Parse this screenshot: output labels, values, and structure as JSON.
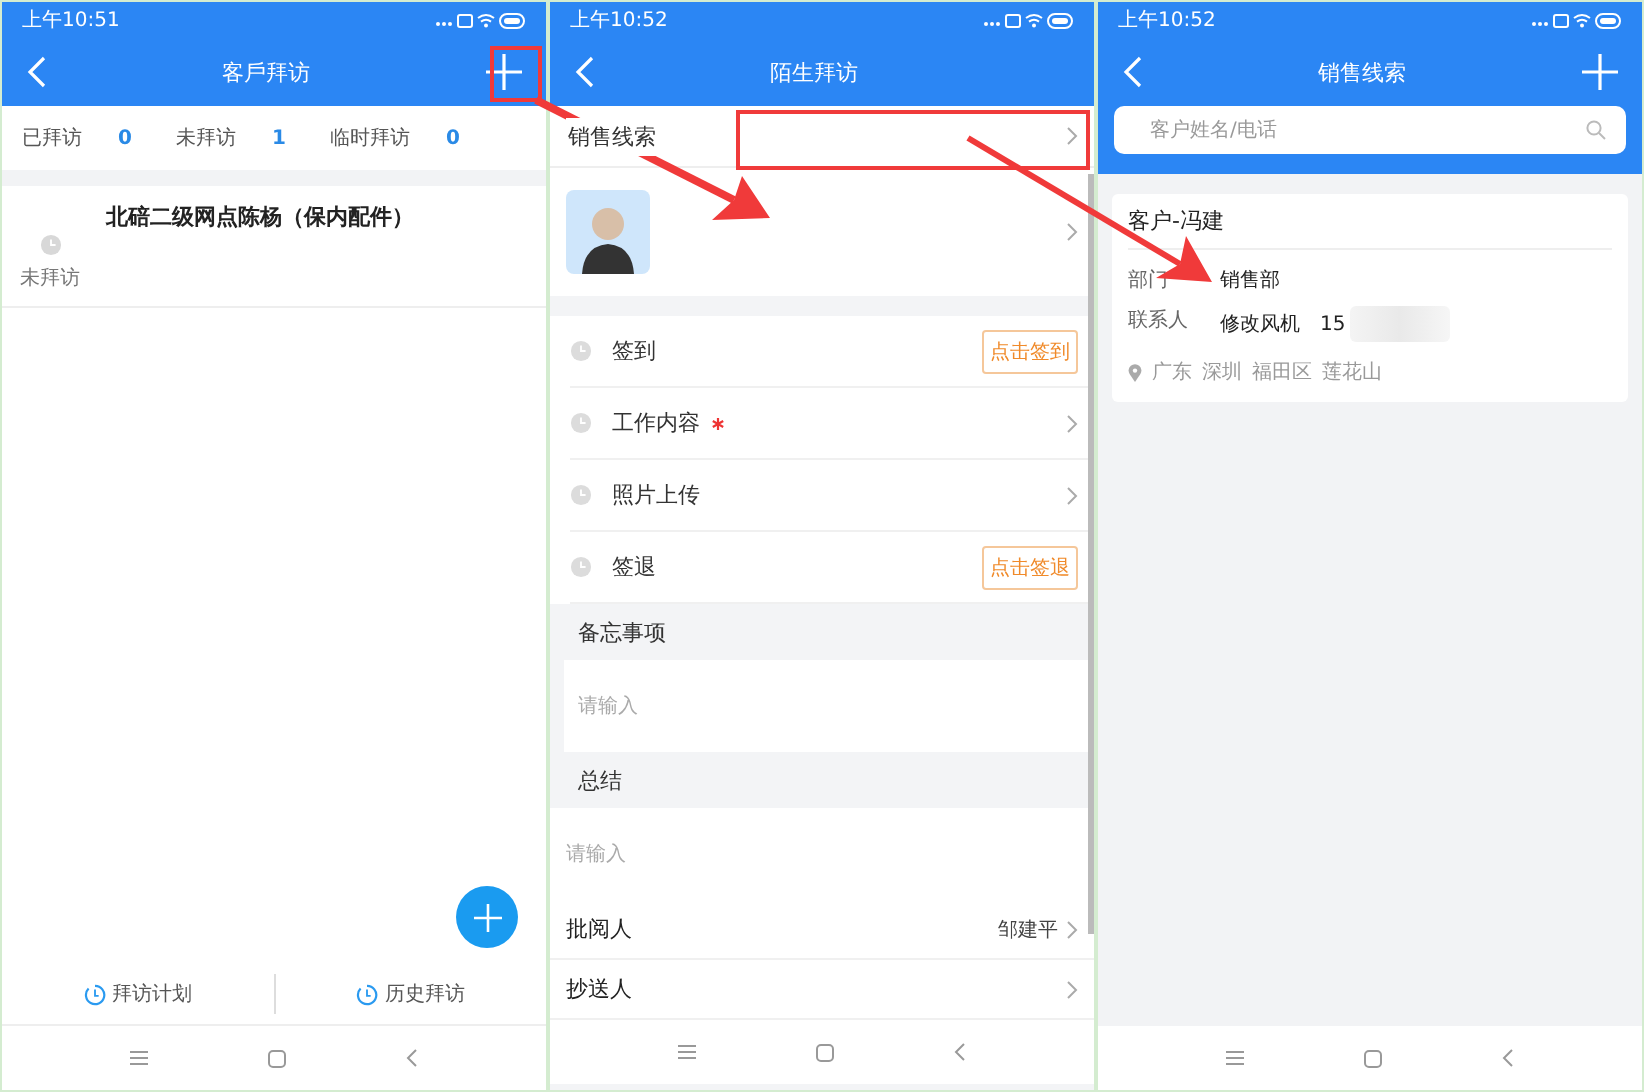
{
  "screen_1": {
    "status_time": "上午10:51",
    "title": "客戶拜访",
    "stats": [
      {
        "label": "已拜访",
        "count": "0"
      },
      {
        "label": "未拜访",
        "count": "1"
      },
      {
        "label": "临时拜访",
        "count": "0"
      }
    ],
    "visits": [
      {
        "status": "未拜访",
        "name": "北碚二级网点陈杨（保内配件）"
      }
    ],
    "bottom_tabs": [
      "拜访计划",
      "历史拜访"
    ]
  },
  "screen_2": {
    "status_time": "上午10:52",
    "title": "陌生拜访",
    "lead_label": "销售线索",
    "steps": [
      {
        "kind": "button",
        "label": "签到",
        "action": "点击签到"
      },
      {
        "kind": "link",
        "label": "工作内容",
        "required": true
      },
      {
        "kind": "link",
        "label": "照片上传",
        "required": false
      },
      {
        "kind": "button",
        "label": "签退",
        "action": "点击签退"
      }
    ],
    "notes": [
      {
        "heading": "备忘事项",
        "placeholder": "请输入"
      },
      {
        "heading": "总结",
        "placeholder": "请输入"
      }
    ],
    "people": [
      {
        "label": "批阅人",
        "value": "邹建平"
      },
      {
        "label": "抄送人"
      }
    ]
  },
  "screen_3": {
    "status_time": "上午10:52",
    "title": "销售线索",
    "search": {
      "placeholder": "客户姓名/电话"
    },
    "card": {
      "title": "客户-冯建",
      "department_label": "部门",
      "department": "销售部",
      "contact_label": "联系人",
      "contact_name": "修改风机",
      "phone": "15",
      "location": [
        "广东",
        "深圳",
        "福田区",
        "莲花山"
      ]
    }
  }
}
